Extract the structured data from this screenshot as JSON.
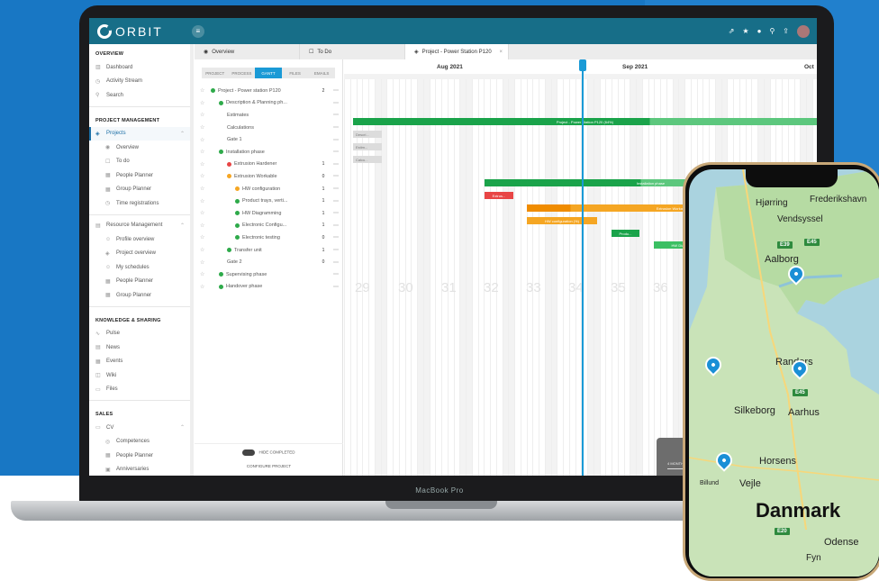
{
  "app": {
    "name": "ORBIT",
    "device_label": "MacBook Pro"
  },
  "sidebar": {
    "sections": [
      {
        "title": "OVERVIEW",
        "items": [
          {
            "label": "Dashboard",
            "icon": "chart-icon"
          },
          {
            "label": "Activity Stream",
            "icon": "activity-icon"
          },
          {
            "label": "Search",
            "icon": "search-icon"
          }
        ]
      },
      {
        "title": "PROJECT MANAGEMENT",
        "items": [
          {
            "label": "Projects",
            "icon": "cube-icon",
            "active": true
          },
          {
            "label": "Overview",
            "sub": true
          },
          {
            "label": "To do",
            "sub": true
          },
          {
            "label": "People Planner",
            "sub": true
          },
          {
            "label": "Group Planner",
            "sub": true
          },
          {
            "label": "Time registrations",
            "sub": true
          },
          {
            "label": "Resource Management",
            "icon": "resource-icon"
          },
          {
            "label": "Profile overview",
            "sub": true
          },
          {
            "label": "Project overview",
            "sub": true
          },
          {
            "label": "My schedules",
            "sub": true
          },
          {
            "label": "People Planner",
            "sub": true
          },
          {
            "label": "Group Planner",
            "sub": true
          }
        ]
      },
      {
        "title": "KNOWLEDGE & SHARING",
        "items": [
          {
            "label": "Pulse"
          },
          {
            "label": "News"
          },
          {
            "label": "Events"
          },
          {
            "label": "Wiki"
          },
          {
            "label": "Files"
          }
        ]
      },
      {
        "title": "SALES",
        "items": [
          {
            "label": "CV"
          },
          {
            "label": "Competences",
            "sub": true
          },
          {
            "label": "People Planner",
            "sub": true
          },
          {
            "label": "Anniversaries",
            "sub": true
          }
        ]
      }
    ]
  },
  "tabs": [
    {
      "label": "Overview"
    },
    {
      "label": "To Do"
    },
    {
      "label": "Project - Power Station P120",
      "active": true
    }
  ],
  "view_tabs": [
    {
      "label": "PROJECT"
    },
    {
      "label": "PROCESS"
    },
    {
      "label": "GANTT",
      "active": true
    },
    {
      "label": "FILES"
    },
    {
      "label": "EMAILS"
    }
  ],
  "tree": [
    {
      "label": "Project - Power station P120",
      "color": "#2eaa4a",
      "count": "2"
    },
    {
      "label": "Description & Planning ph...",
      "color": "#2eaa4a"
    },
    {
      "label": "Estimates"
    },
    {
      "label": "Calculations"
    },
    {
      "label": "Gate 1"
    },
    {
      "label": "Installation phase",
      "color": "#2eaa4a"
    },
    {
      "label": "Extrusion Hardener",
      "color": "#e84545",
      "count": "1"
    },
    {
      "label": "Extrusion Workable",
      "color": "#f5a623",
      "count": "0"
    },
    {
      "label": "HW configuration",
      "color": "#f5a623",
      "count": "1"
    },
    {
      "label": "Product trays, verti...",
      "color": "#2eaa4a",
      "count": "1"
    },
    {
      "label": "HW Diagramming",
      "color": "#2eaa4a",
      "count": "1"
    },
    {
      "label": "Electronic Configu...",
      "color": "#2eaa4a",
      "count": "1"
    },
    {
      "label": "Electronic testing",
      "color": "#2eaa4a",
      "count": "0"
    },
    {
      "label": "Transfer unit",
      "color": "#2eaa4a",
      "count": "1"
    },
    {
      "label": "Gate 2",
      "count": "0"
    },
    {
      "label": "Supervising phase",
      "color": "#2eaa4a"
    },
    {
      "label": "Handover phase",
      "color": "#2eaa4a"
    }
  ],
  "tree_footer": {
    "hide_completed": "HIDE COMPLETED",
    "configure": "CONFIGURE PROJECT"
  },
  "gantt": {
    "months": [
      "Aug 2021",
      "Sep 2021",
      "Oct"
    ],
    "weeks": [
      "29",
      "30",
      "31",
      "32",
      "33",
      "34",
      "35",
      "36"
    ],
    "bars": [
      {
        "label": "Project - Power Station P120 (64%)"
      },
      {
        "label": "Descri..."
      },
      {
        "label": "Estim..."
      },
      {
        "label": "Calcu..."
      },
      {
        "label": "Installation phase"
      },
      {
        "label": "Extrus..."
      },
      {
        "label": "Extrusion Workable"
      },
      {
        "label": "HW configuration (%)"
      },
      {
        "label": "Produ..."
      },
      {
        "label": "HW Diagramming (%)"
      },
      {
        "label": "Electronic C"
      }
    ],
    "hint": "Hint: you can use the + and - keys o",
    "zoom_options": [
      "4 MONTH",
      "2 MONTHS",
      "4 MONTH"
    ]
  },
  "map": {
    "places": [
      "Hjørring",
      "Frederikshavn",
      "Vendsyssel",
      "Aalborg",
      "Randers",
      "Silkeborg",
      "Aarhus",
      "Horsens",
      "Billund",
      "Vejle",
      "Odense",
      "Fyn"
    ],
    "country": "Danmark",
    "roads": [
      "E39",
      "E45",
      "E45",
      "E20"
    ]
  }
}
